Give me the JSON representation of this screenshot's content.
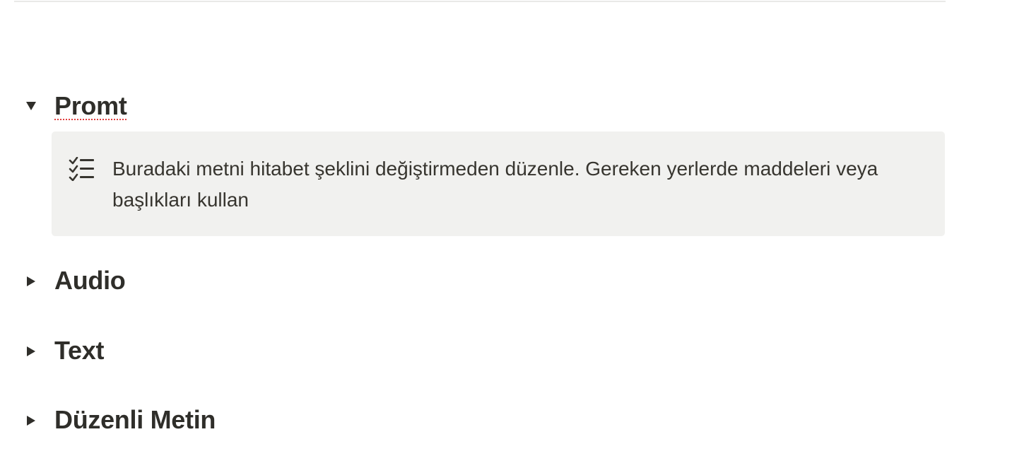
{
  "toggles": [
    {
      "title": "Promt",
      "expanded": true
    },
    {
      "title": "Audio",
      "expanded": false
    },
    {
      "title": "Text",
      "expanded": false
    },
    {
      "title": "Düzenli Metin",
      "expanded": false
    }
  ],
  "callout": {
    "icon": "checklist-icon",
    "text": "Buradaki metni hitabet şeklini değiştirmeden düzenle. Gereken yerlerde maddeleri veya başlıkları kullan"
  },
  "colors": {
    "text": "#37352f",
    "callout_background": "#f1f1ef",
    "divider": "#e9e9e7",
    "spellcheck_underline": "#e03e3e"
  }
}
